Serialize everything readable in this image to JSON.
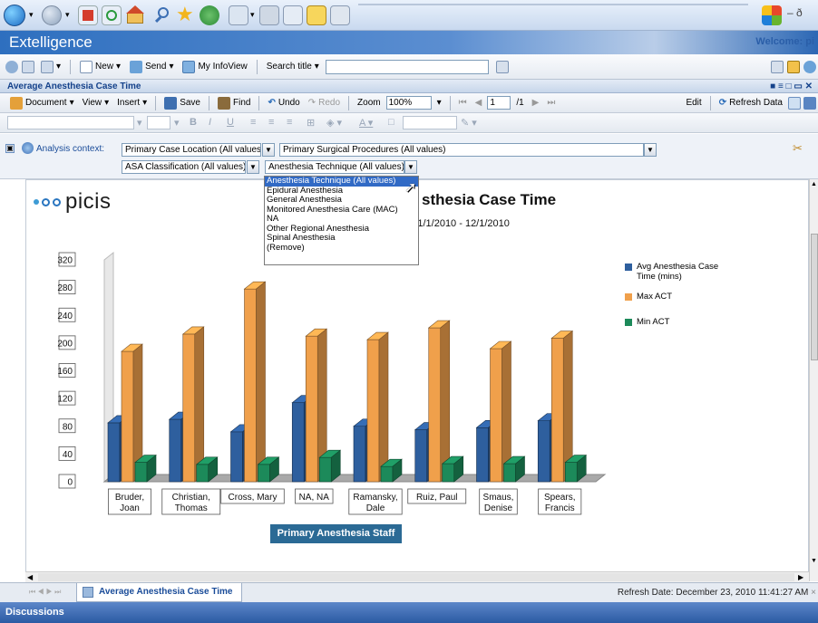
{
  "app": {
    "title": "Extelligence",
    "welcome": "Welcome: pi"
  },
  "toolbar1": {
    "new_label": "New",
    "send_label": "Send",
    "infoview_label": "My InfoView",
    "search_label": "Search title"
  },
  "document_title": "Average Anesthesia Case Time",
  "toolbar2": {
    "document": "Document",
    "view": "View",
    "insert": "Insert",
    "save": "Save",
    "find": "Find",
    "undo": "Undo",
    "redo": "Redo",
    "zoom_label": "Zoom",
    "zoom_value": "100%",
    "page_value": "1",
    "page_total": "/1",
    "edit": "Edit",
    "refresh": "Refresh Data"
  },
  "analysis": {
    "label": "Analysis context:",
    "filters": [
      "Primary Case Location (All values)",
      "Primary Surgical Procedures (All values)",
      "ASA Classification (All values)",
      "Anesthesia Technique (All values)"
    ],
    "dropdown_options": [
      "Anesthesia Technique (All values)",
      "Epidural Anesthesia",
      "General Anesthesia",
      "Monitored Anesthesia Care (MAC)",
      "NA",
      "Other Regional Anesthesia",
      "Spinal Anesthesia",
      "(Remove)"
    ]
  },
  "report": {
    "logo": "picis",
    "title": "sthesia Case Time",
    "date_range": ":11/1/2010 - 12/1/2010"
  },
  "chart_data": {
    "type": "bar",
    "categories": [
      "Bruder, Joan",
      "Christian, Thomas",
      "Cross, Mary",
      "NA, NA",
      "Ramansky, Dale",
      "Ruiz, Paul",
      "Smaus, Denise",
      "Spears, Francis"
    ],
    "series": [
      {
        "name": "Avg Anesthesia Case Time (mins)",
        "color": "#2e5f9e",
        "values": [
          85,
          90,
          72,
          114,
          80,
          75,
          78,
          88
        ]
      },
      {
        "name": "Max ACT",
        "color": "#f0a04b",
        "values": [
          188,
          213,
          278,
          210,
          205,
          222,
          192,
          207
        ]
      },
      {
        "name": "Min ACT",
        "color": "#1c8a5a",
        "values": [
          28,
          25,
          25,
          35,
          22,
          26,
          26,
          28
        ]
      }
    ],
    "yticks": [
      "320",
      "280",
      "240",
      "200",
      "160",
      "120",
      "80",
      "40",
      "0"
    ],
    "ylim": [
      0,
      320
    ],
    "xlabel": "Primary Anesthesia Staff",
    "legend": "right"
  },
  "footer": {
    "tab_label": "Average Anesthesia Case Time",
    "refresh_date": "Refresh Date: December 23, 2010 11:41:27 AM",
    "discussions": "Discussions"
  }
}
